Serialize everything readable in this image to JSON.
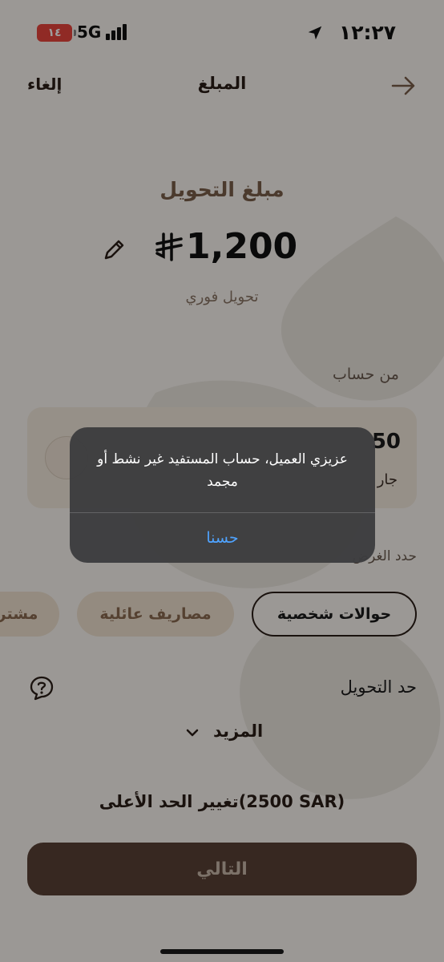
{
  "status_bar": {
    "time": "١٢:٢٧",
    "battery": "١٤",
    "network": "5G"
  },
  "nav": {
    "title": "المبلغ",
    "cancel": "إلغاء"
  },
  "amount": {
    "caption": "مبلغ التحويل",
    "value": "1,200",
    "transfer_type": "تحويل فوري"
  },
  "from_account": {
    "label": "من حساب",
    "balance_partial": "50",
    "type_partial": "جار"
  },
  "purpose": {
    "label_partial": "حدد الغرض",
    "chips": [
      {
        "label": "حوالات شخصية",
        "selected": true
      },
      {
        "label": "مصاريف عائلية",
        "selected": false
      },
      {
        "label": "مشتر",
        "selected": false
      }
    ]
  },
  "limit": {
    "label": "حد التحويل",
    "more": "المزيد",
    "change_limit": "تغيير الحد الأعلى(2500 SAR)"
  },
  "next_button": "التالي",
  "alert": {
    "message": "عزيزي العميل، حساب المستفيد غير نشط أو مجمد",
    "ok": "حسنا"
  },
  "colors": {
    "background": "#faf6f0",
    "brand_brown": "#5a4236",
    "accent_text": "#7a5e4a",
    "alert_link": "#4fa3ff",
    "battery_low": "#e8453c"
  },
  "icons": [
    "location-arrow-icon",
    "signal-bars-icon",
    "arrow-right-icon",
    "riyal-currency-icon",
    "pencil-icon",
    "chevron-down-icon",
    "question-bubble-icon"
  ]
}
